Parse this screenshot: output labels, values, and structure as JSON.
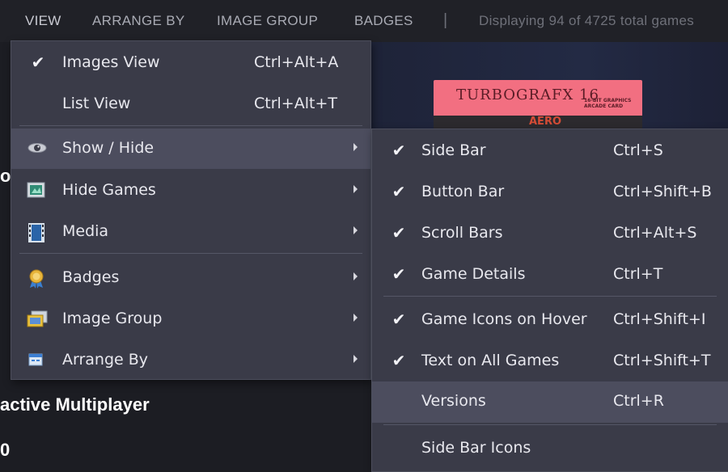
{
  "toolbar": {
    "items": [
      "VIEW",
      "ARRANGE BY",
      "IMAGE GROUP",
      "BADGES"
    ],
    "separator": "|",
    "status": "Displaying 94 of 4725 total games"
  },
  "background": {
    "line1": "active Multiplayer",
    "line2": "0",
    "line3": "o",
    "box_art": {
      "logo": "TURBOGRAFX 16",
      "subtitle": "16-BIT GRAPHICS ARCADE CARD",
      "strip_title": "AERO"
    }
  },
  "view_menu": {
    "items": [
      {
        "label": "Images View",
        "shortcut": "Ctrl+Alt+A",
        "checked": true
      },
      {
        "label": "List View",
        "shortcut": "Ctrl+Alt+T",
        "checked": false
      },
      {
        "label": "Show / Hide",
        "icon": "eye-icon",
        "submenu": true,
        "highlighted": true
      },
      {
        "label": "Hide Games",
        "icon": "hide-games-icon",
        "submenu": true
      },
      {
        "label": "Media",
        "icon": "film-strip-icon",
        "submenu": true
      },
      {
        "label": "Badges",
        "icon": "badge-medal-icon",
        "submenu": true
      },
      {
        "label": "Image Group",
        "icon": "image-group-icon",
        "submenu": true
      },
      {
        "label": "Arrange By",
        "icon": "arrange-icon",
        "submenu": true
      }
    ]
  },
  "show_hide_menu": {
    "items": [
      {
        "label": "Side Bar",
        "shortcut": "Ctrl+S",
        "checked": true
      },
      {
        "label": "Button Bar",
        "shortcut": "Ctrl+Shift+B",
        "checked": true
      },
      {
        "label": "Scroll Bars",
        "shortcut": "Ctrl+Alt+S",
        "checked": true
      },
      {
        "label": "Game Details",
        "shortcut": "Ctrl+T",
        "checked": true
      },
      {
        "label": "Game Icons on Hover",
        "shortcut": "Ctrl+Shift+I",
        "checked": true
      },
      {
        "label": "Text on All Games",
        "shortcut": "Ctrl+Shift+T",
        "checked": true
      },
      {
        "label": "Versions",
        "shortcut": "Ctrl+R",
        "checked": false,
        "highlighted": true
      },
      {
        "label": "Side Bar Icons",
        "shortcut": "",
        "checked": false
      }
    ]
  },
  "check_glyph": "✔",
  "colors": {
    "menu_bg": "#3a3b48",
    "menu_highlight": "#4c4d5e",
    "toolbar_bg": "#202127",
    "box_art_pink": "#f26f81"
  }
}
